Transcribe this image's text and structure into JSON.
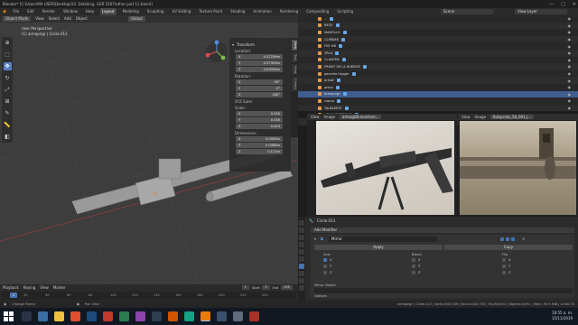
{
  "window": {
    "title": "Blender* [C:\\Users\\MA USER\\Desktop\\10. Detailing. GSR 1507\\other part 11.blend]",
    "controls": [
      "—",
      "□",
      "✕"
    ]
  },
  "menu": {
    "items": [
      "File",
      "Edit",
      "Render",
      "Window",
      "Help"
    ],
    "workspaces": [
      "Layout",
      "Modeling",
      "Sculpting",
      "UV Editing",
      "Texture Paint",
      "Shading",
      "Animation",
      "Rendering",
      "Compositing",
      "Scripting"
    ],
    "active_workspace": "Layout",
    "scene": "Scene",
    "view_layer": "View Layer"
  },
  "viewport": {
    "header": {
      "mode": "Object Mode",
      "items": [
        "View",
        "Select",
        "Add",
        "Object"
      ],
      "transform_orientation": "Global"
    },
    "info_line1": "User Perspective",
    "info_line2": "(1) armapngr | Circle.013",
    "tools": [
      "cursor",
      "select",
      "move",
      "rotate",
      "scale",
      "transform",
      "annotate",
      "measure",
      "add-cube"
    ],
    "npanel": {
      "transform_label": "Transform",
      "location_label": "Location:",
      "location": [
        {
          "axis": "X",
          "value": "0.37239m"
        },
        {
          "axis": "Y",
          "value": "0.37393m"
        },
        {
          "axis": "Z",
          "value": "0.03334m"
        }
      ],
      "rotation_label": "Rotation:",
      "rotation": [
        {
          "axis": "X",
          "value": "90°"
        },
        {
          "axis": "Y",
          "value": "0°"
        },
        {
          "axis": "Z",
          "value": "180°"
        }
      ],
      "rotation_mode": "XYZ Euler",
      "scale_label": "Scale:",
      "scale": [
        {
          "axis": "X",
          "value": "0.330"
        },
        {
          "axis": "Y",
          "value": "0.330"
        },
        {
          "axis": "Z",
          "value": "0.443"
        }
      ],
      "dimensions_label": "Dimensions:",
      "dimensions": [
        {
          "axis": "X",
          "value": "0.0563m"
        },
        {
          "axis": "Y",
          "value": "0.0486m"
        },
        {
          "axis": "Z",
          "value": "0.121m"
        }
      ]
    },
    "side_tabs": [
      "Item",
      "Tool",
      "View",
      "Create"
    ]
  },
  "timeline": {
    "items": [
      "Playback",
      "Keying",
      "View",
      "Marker"
    ],
    "current_frame": "1",
    "start_label": "Start",
    "start": "1",
    "end_label": "End",
    "end": "250",
    "ticks": [
      "0",
      "20",
      "40",
      "60",
      "80",
      "100",
      "120",
      "140",
      "160",
      "180",
      "200",
      "220",
      "240"
    ]
  },
  "status": {
    "left": "Change Frame",
    "mid": "Pan View",
    "right": "armapngr | Circle.013 | Verts:0/43,309 | Faces:0/43,730 | Tris:86,620 | Objects:0/291 | Mem: 93.5 MiB | v2.80.75"
  },
  "outliner": {
    "rows": [
      "...",
      "RECE",
      "MAGFILLE",
      "CLIMDEK",
      "FEE HB",
      "TRLG",
      "CLANTEB",
      "FRONT GR LL KUKROS",
      "ganchio trigger",
      "armat",
      "pistol",
      "armapngr",
      "clamp",
      "TALBLEEST",
      "HRUM POPIBDOR",
      "clamping",
      "TORNILLOR"
    ],
    "selected_index": 11
  },
  "image_editor_1": {
    "menu": [
      "View",
      "Image"
    ],
    "file": "armag08-machine..."
  },
  "image_editor_2": {
    "menu": [
      "View",
      "Image"
    ],
    "file": "Kulspruta_58_001.j..."
  },
  "properties": {
    "object": "Circle.013",
    "add_modifier": "Add Modifier",
    "modifier_name": "Mirror",
    "apply": "Apply",
    "copy": "Copy",
    "axis_label": "Axis",
    "bisect_label": "Bisect",
    "flip_label": "Flip",
    "axes": [
      "X",
      "Y",
      "Z"
    ],
    "mirror_object": "Mirror Object:",
    "options": "Options"
  },
  "taskbar": {
    "time": "10:55 a. m.",
    "date": "15/11/2019"
  },
  "colors": {
    "accent": "#4772b3",
    "selection": "#3f5d8f",
    "viewport_bg": "#3d3d3d"
  }
}
